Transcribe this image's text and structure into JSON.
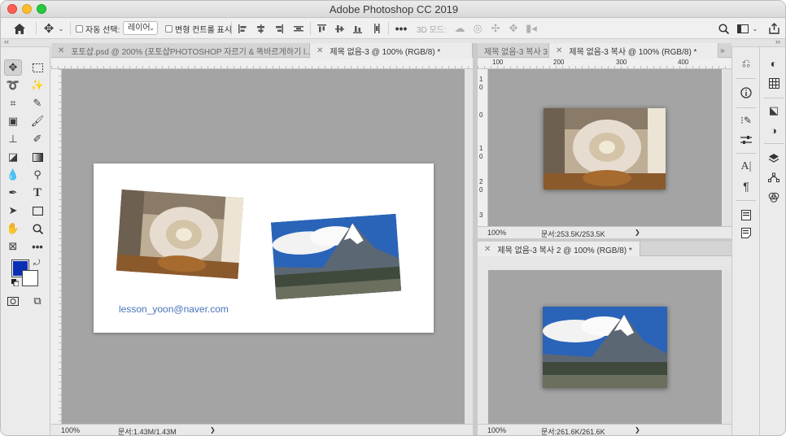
{
  "window": {
    "title": "Adobe Photoshop CC 2019"
  },
  "options": {
    "auto_select_label": "자동 선택:",
    "auto_select_value": "레이어",
    "transform_controls_label": "변형 컨트롤 표시",
    "mode_3d_label": "3D 모드:"
  },
  "tabs": {
    "left": [
      {
        "label": "포토샵.psd @ 200% (포토샵PHOTOSHOP 자르기 & 똑바르게하기 l...",
        "close": "✕"
      },
      {
        "label": "제목 없음-3 @ 100% (RGB/8) *",
        "close": "✕"
      }
    ],
    "right_top": [
      {
        "label": "제목 없음-3 복사 3"
      },
      {
        "label": "제목 없음-3 복사 @ 100% (RGB/8) *",
        "close": "✕"
      }
    ],
    "right_bottom": [
      {
        "label": "제목 없음-3 복사 2 @ 100% (RGB/8) *",
        "close": "✕"
      }
    ]
  },
  "documents": {
    "left": {
      "caption": "lesson_yoon@naver.com",
      "zoom": "100%",
      "docsize": "문서:1.43M/1.43M",
      "arrow": "❯"
    },
    "right_top": {
      "zoom": "100%",
      "docsize": "문서:253.5K/253.5K",
      "arrow": "❯"
    },
    "right_bottom": {
      "zoom": "100%",
      "docsize": "문서:261.6K/261.6K",
      "arrow": "❯"
    }
  },
  "rulers": {
    "top_right": [
      "100",
      "200",
      "300",
      "400"
    ],
    "side_right_top": [
      "1",
      "0",
      "0",
      "1",
      "0",
      "2",
      "0",
      "3"
    ]
  },
  "panel_overflow": "»",
  "colors": {
    "foreground": "#0a2fb5",
    "background": "#ffffff",
    "canvas": "#a4a4a4",
    "email": "#4a74b8"
  }
}
